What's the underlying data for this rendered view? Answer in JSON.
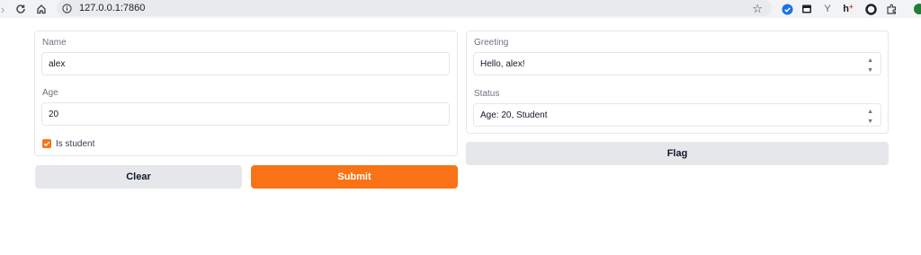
{
  "browser": {
    "url": "127.0.0.1:7860",
    "extensions": [
      "checkmark-shield-icon",
      "reader-icon",
      "y-icon",
      "h-icon",
      "circle-icon",
      "puzzle-icon",
      "profile-avatar"
    ]
  },
  "inputs": {
    "name": {
      "label": "Name",
      "value": "alex"
    },
    "age": {
      "label": "Age",
      "value": "20"
    },
    "student": {
      "label": "Is student",
      "checked": true
    }
  },
  "outputs": {
    "greeting": {
      "label": "Greeting",
      "value": "Hello, alex!"
    },
    "status": {
      "label": "Status",
      "value": "Age: 20, Student"
    }
  },
  "buttons": {
    "clear": "Clear",
    "submit": "Submit",
    "flag": "Flag"
  },
  "colors": {
    "accent": "#f97316",
    "button_grey": "#e5e7eb"
  }
}
